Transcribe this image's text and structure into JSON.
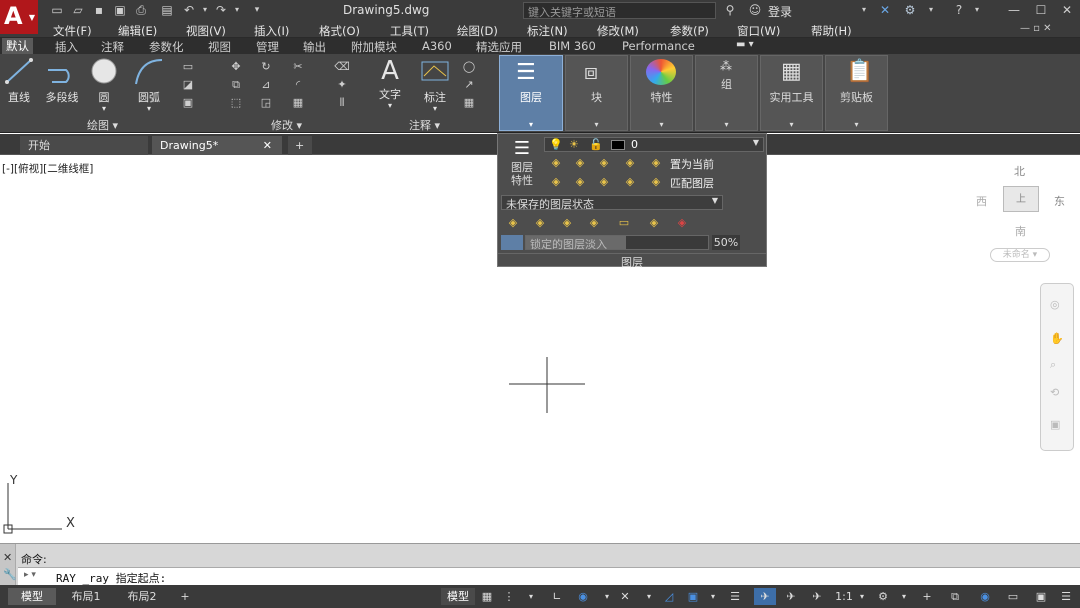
{
  "app": {
    "logo_letter": "A",
    "doc_title": "Drawing5.dwg",
    "search_placeholder": "键入关键字或短语",
    "login": "登录"
  },
  "menu": [
    "文件(F)",
    "编辑(E)",
    "视图(V)",
    "插入(I)",
    "格式(O)",
    "工具(T)",
    "绘图(D)",
    "标注(N)",
    "修改(M)",
    "参数(P)",
    "窗口(W)",
    "帮助(H)"
  ],
  "ribbon_tabs": [
    "默认",
    "插入",
    "注释",
    "参数化",
    "视图",
    "管理",
    "输出",
    "附加模块",
    "A360",
    "精选应用",
    "BIM 360",
    "Performance"
  ],
  "draw_tools": {
    "line": "直线",
    "polyline": "多段线",
    "circle": "圆",
    "arc": "圆弧"
  },
  "panels": {
    "draw": "绘图",
    "modify": "修改",
    "annotation": "注释"
  },
  "annot_tools": {
    "text": "文字",
    "dim": "标注"
  },
  "big_tools": {
    "layer": "图层",
    "block": "块",
    "props": "特性",
    "group": "组",
    "utils": "实用工具",
    "clipboard": "剪贴板"
  },
  "doc_tabs": {
    "start": "开始",
    "drawing": "Drawing5*",
    "add": "+"
  },
  "viewport_label": "[-][俯视][二维线框]",
  "layer_panel": {
    "props_label_1": "图层",
    "props_label_2": "特性",
    "current_layer": "0",
    "set_current": "置为当前",
    "match_layer": "匹配图层",
    "state": "未保存的图层状态",
    "lock_fade": "锁定的图层淡入",
    "fade_percent": "50%",
    "title": "图层"
  },
  "viewcube": {
    "north": "北",
    "south": "南",
    "east": "东",
    "west": "西",
    "top": "上",
    "wcs": "未命名"
  },
  "ucs": {
    "x": "X",
    "y": "Y"
  },
  "command": {
    "prompt": "命令:",
    "line": "RAY _ray 指定起点:"
  },
  "status_tabs": {
    "model": "模型",
    "layout1": "布局1",
    "layout2": "布局2",
    "add": "+"
  },
  "status_items": {
    "model_space": "模型",
    "scale": "1:1"
  },
  "colors": {
    "accent_red": "#b1171b",
    "selected_panel": "#5e7fa6"
  }
}
